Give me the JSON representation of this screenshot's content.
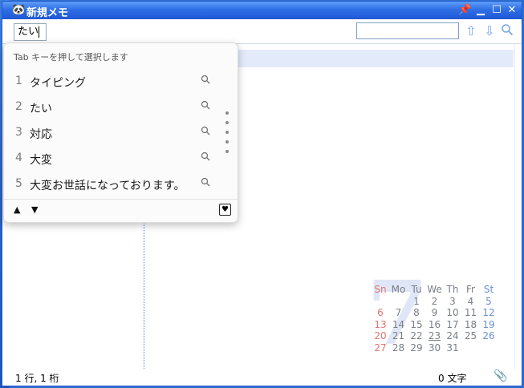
{
  "window": {
    "title": "新規メモ"
  },
  "toolbar": {
    "ime_text": "たい",
    "search_value": ""
  },
  "status": {
    "position": "1 行, 1 桁",
    "char_count": "0 文字"
  },
  "ime_popup": {
    "hint": "Tab キーを押して選択します",
    "candidates": [
      {
        "num": "1",
        "text": "タイピング"
      },
      {
        "num": "2",
        "text": "たい"
      },
      {
        "num": "3",
        "text": "対応"
      },
      {
        "num": "4",
        "text": "大変"
      },
      {
        "num": "5",
        "text": "大変お世話になっております。"
      }
    ]
  },
  "calendar": {
    "month": "7",
    "headers": [
      "Sn",
      "Mo",
      "Tu",
      "We",
      "Th",
      "Fr",
      "St"
    ],
    "weeks": [
      [
        "",
        "",
        "1",
        "2",
        "3",
        "4",
        "5"
      ],
      [
        "6",
        "7",
        "8",
        "9",
        "10",
        "11",
        "12"
      ],
      [
        "13",
        "14",
        "15",
        "16",
        "17",
        "18",
        "19"
      ],
      [
        "20",
        "21",
        "22",
        "23",
        "24",
        "25",
        "26"
      ],
      [
        "27",
        "28",
        "29",
        "30",
        "31",
        "",
        ""
      ]
    ],
    "today": "23"
  },
  "icons": {
    "pin": "pin-icon",
    "minimize": "minimize-icon",
    "maximize": "maximize-icon",
    "close": "close-icon",
    "search_up": "arrow-up-icon",
    "search_down": "arrow-down-icon",
    "search": "search-icon",
    "attachment": "paperclip-icon"
  },
  "colors": {
    "titlebar": "#2f6fe6",
    "highlight_row": "#e3ebfb",
    "sunday": "#e3736e",
    "saturday": "#6a8fd6"
  }
}
